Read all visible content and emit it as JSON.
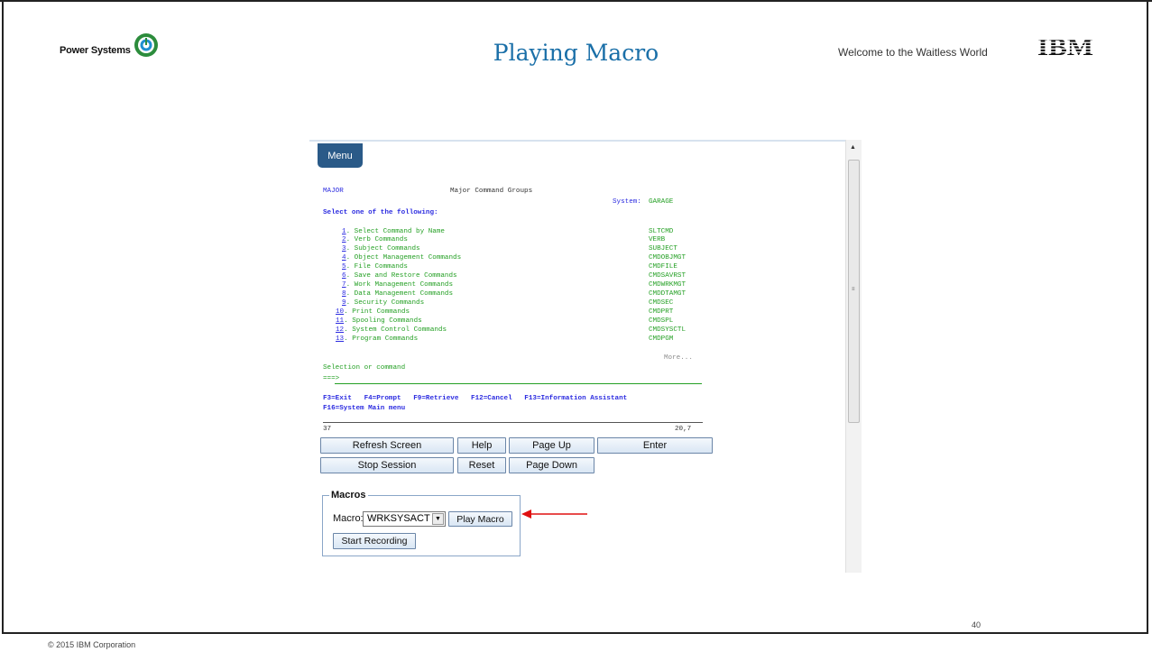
{
  "slide": {
    "brand": "Power Systems",
    "title": "Playing Macro",
    "tagline": "Welcome to the Waitless World",
    "logo_text": "IBM",
    "page_number": "40",
    "copyright": "© 2015 IBM Corporation"
  },
  "screen": {
    "menu_label": "Menu",
    "menu_name": "MAJOR",
    "screen_title": "Major Command Groups",
    "system_label": "System:",
    "system_name": "GARAGE",
    "prompt": "Select one of the following:",
    "options": [
      {
        "num": "1",
        "label": ". Select Command by Name",
        "cmd": "SLTCMD"
      },
      {
        "num": "2",
        "label": ". Verb Commands",
        "cmd": "VERB"
      },
      {
        "num": "3",
        "label": ". Subject Commands",
        "cmd": "SUBJECT"
      },
      {
        "num": "4",
        "label": ". Object Management Commands",
        "cmd": "CMDOBJMGT"
      },
      {
        "num": "5",
        "label": ". File Commands",
        "cmd": "CMDFILE"
      },
      {
        "num": "6",
        "label": ". Save and Restore Commands",
        "cmd": "CMDSAVRST"
      },
      {
        "num": "7",
        "label": ". Work Management Commands",
        "cmd": "CMDWRKMGT"
      },
      {
        "num": "8",
        "label": ". Data Management Commands",
        "cmd": "CMDDTAMGT"
      },
      {
        "num": "9",
        "label": ". Security Commands",
        "cmd": "CMDSEC"
      },
      {
        "num": "10",
        "label": ". Print Commands",
        "cmd": "CMDPRT"
      },
      {
        "num": "11",
        "label": ". Spooling Commands",
        "cmd": "CMDSPL"
      },
      {
        "num": "12",
        "label": ". System Control Commands",
        "cmd": "CMDSYSCTL"
      },
      {
        "num": "13",
        "label": ". Program Commands",
        "cmd": "CMDPGM"
      }
    ],
    "more": "More...",
    "selection_label": "Selection or command",
    "command_prompt": "===>",
    "fkeys_line1": "F3=Exit   F4=Prompt   F9=Retrieve   F12=Cancel   F13=Information Assistant",
    "fkeys_line2": "F16=System Main menu",
    "status_left": "37",
    "status_right": "20,7"
  },
  "buttons": {
    "refresh": "Refresh Screen",
    "help": "Help",
    "page_up": "Page Up",
    "enter": "Enter",
    "stop": "Stop Session",
    "reset": "Reset",
    "page_down": "Page Down"
  },
  "macros": {
    "legend": "Macros",
    "label": "Macro:",
    "selected": "WRKSYSACT",
    "play": "Play Macro",
    "record": "Start Recording"
  },
  "colors": {
    "title": "#1a6fa8",
    "terminal_green": "#25a025",
    "terminal_blue": "#2b2be0",
    "arrow": "#e01010",
    "menu_tab": "#2a5a88"
  }
}
